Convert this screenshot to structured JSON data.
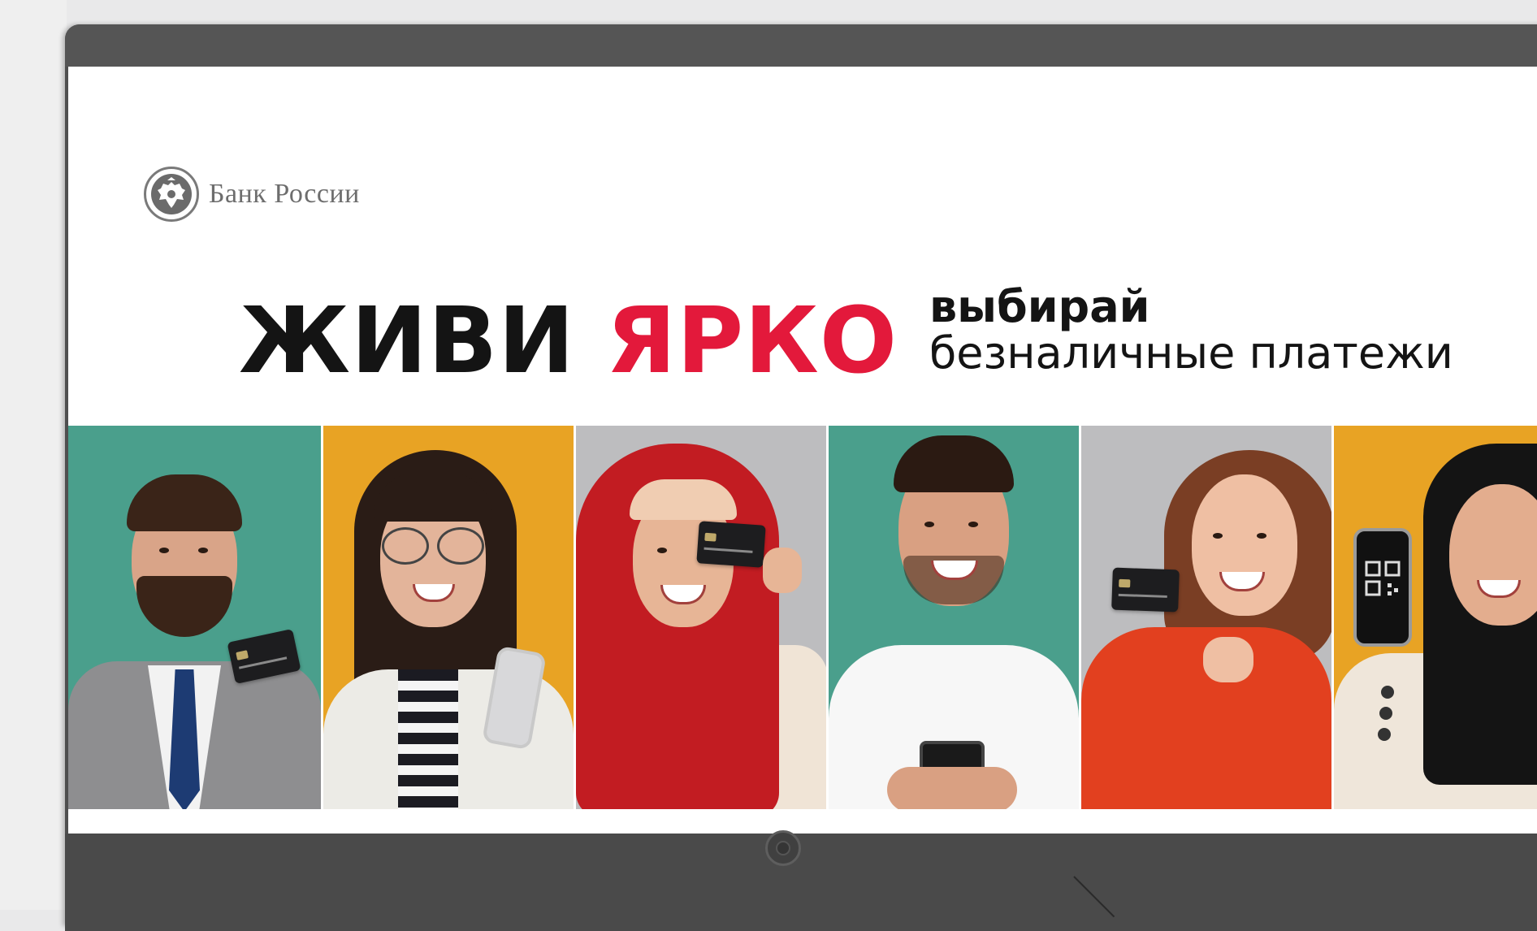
{
  "brand": {
    "name": "Банк России",
    "emblem_icon": "double-headed-eagle-icon"
  },
  "headline": {
    "word1": "ЖИВИ",
    "word2": "ЯРКО",
    "slogan_line1": "выбирай",
    "slogan_line2": "безналичные платежи"
  },
  "colors": {
    "accent_red": "#e3193b",
    "teal": "#4a9f8c",
    "mustard": "#e8a324",
    "gray": "#bdbdbf"
  },
  "panels": [
    {
      "bg": "#4a9f8c",
      "person": "man-in-suit",
      "item": "bank-card-icon"
    },
    {
      "bg": "#e8a324",
      "person": "woman-with-glasses",
      "item": "smartphone-icon"
    },
    {
      "bg": "#bdbdbf",
      "person": "woman-in-red-hijab",
      "item": "bank-card-icon"
    },
    {
      "bg": "#4a9f8c",
      "person": "man-in-white-tshirt",
      "item": "smartphone-icon"
    },
    {
      "bg": "#bdbdbf",
      "person": "woman-in-red-sweater",
      "item": "bank-card-icon"
    },
    {
      "bg": "#e8a324",
      "person": "woman-in-black-hijab",
      "item": "qr-code-phone-icon"
    }
  ]
}
